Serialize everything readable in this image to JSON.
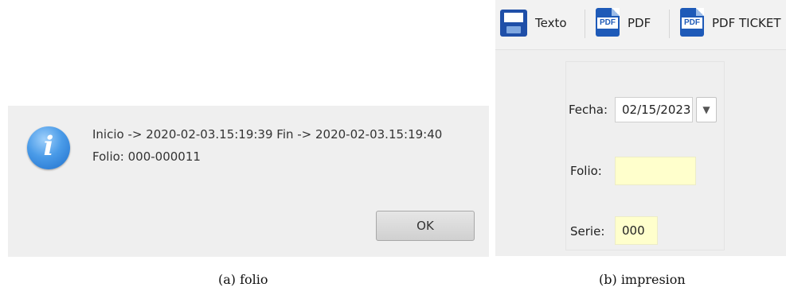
{
  "panel_a": {
    "message_line1": "Inicio -> 2020-02-03.15:19:39  Fin -> 2020-02-03.15:19:40",
    "message_line2": "Folio: 000-000011",
    "icon_glyph": "i",
    "icon": "info-icon",
    "ok_label": "OK"
  },
  "panel_b": {
    "toolbar": {
      "texto_label": "Texto",
      "texto_icon": "floppy-disk-icon",
      "pdf_label": "PDF",
      "pdf_icon": "pdf-icon",
      "pdf_ticket_label": "PDF TICKET",
      "pdf_icon_text": "PDF"
    },
    "form": {
      "fecha_label": "Fecha:",
      "fecha_value": "02/15/2023",
      "dropdown_glyph": "▼",
      "folio_label": "Folio:",
      "folio_value": "",
      "serie_label": "Serie:",
      "serie_value": "000"
    }
  },
  "captions": {
    "a": "(a)  folio",
    "b": "(b)  impresion"
  },
  "colors": {
    "input_highlight": "#ffffcc",
    "icon_blue": "#1e5ab8",
    "info_blue": "#4a9be8"
  }
}
